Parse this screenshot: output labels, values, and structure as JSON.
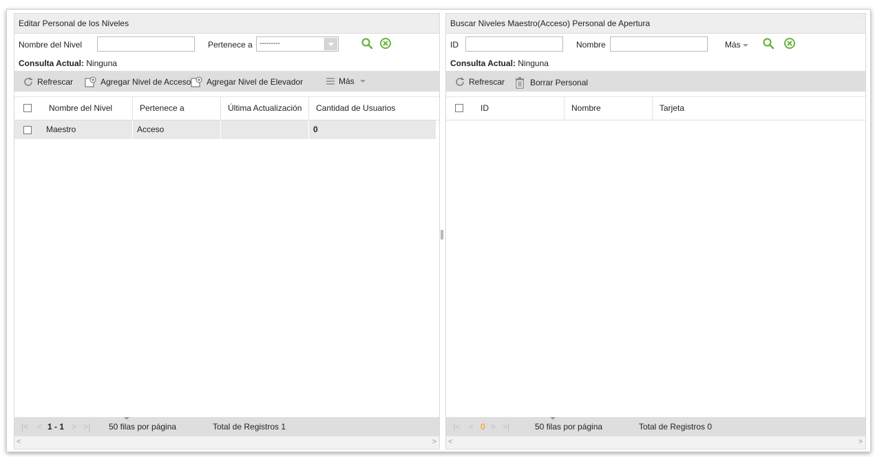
{
  "left": {
    "title": "Editar Personal de los Niveles",
    "collapse_glyph": "‹",
    "search": {
      "level_name_label": "Nombre del Nivel",
      "level_name_value": "",
      "belongs_label": "Pertenece a",
      "belongs_selected": "---------"
    },
    "current_query_label": "Consulta Actual:",
    "current_query_value": "Ninguna",
    "toolbar": {
      "refresh": "Refrescar",
      "add_access": "Agregar Nivel de Acceso",
      "add_elevator": "Agregar Nivel de Elevador",
      "more": "Más"
    },
    "columns": [
      "Nombre del Nivel",
      "Pertenece a",
      "Última Actualización",
      "Cantidad de Usuarios"
    ],
    "rows": [
      {
        "name": "Maestro",
        "belongs": "Acceso",
        "updated": "",
        "users": "0"
      }
    ],
    "footer": {
      "range": "1 - 1",
      "rows_per_page": "50 filas por página",
      "total": "Total de Registros 1"
    }
  },
  "right": {
    "title": "Buscar Niveles Maestro(Acceso) Personal de Apertura",
    "collapse_glyph": "›",
    "search": {
      "id_label": "ID",
      "id_value": "",
      "name_label": "Nombre",
      "name_value": "",
      "more_label": "Más"
    },
    "current_query_label": "Consulta Actual:",
    "current_query_value": "Ninguna",
    "toolbar": {
      "refresh": "Refrescar",
      "delete": "Borrar Personal"
    },
    "columns": [
      "ID",
      "Nombre",
      "Tarjeta"
    ],
    "footer": {
      "page": "0",
      "rows_per_page": "50 filas por página",
      "total": "Total de Registros 0"
    }
  },
  "colors": {
    "accent_green": "#6ab23e",
    "page_orange": "#f39800",
    "toolbar_gray": "#dedede"
  }
}
